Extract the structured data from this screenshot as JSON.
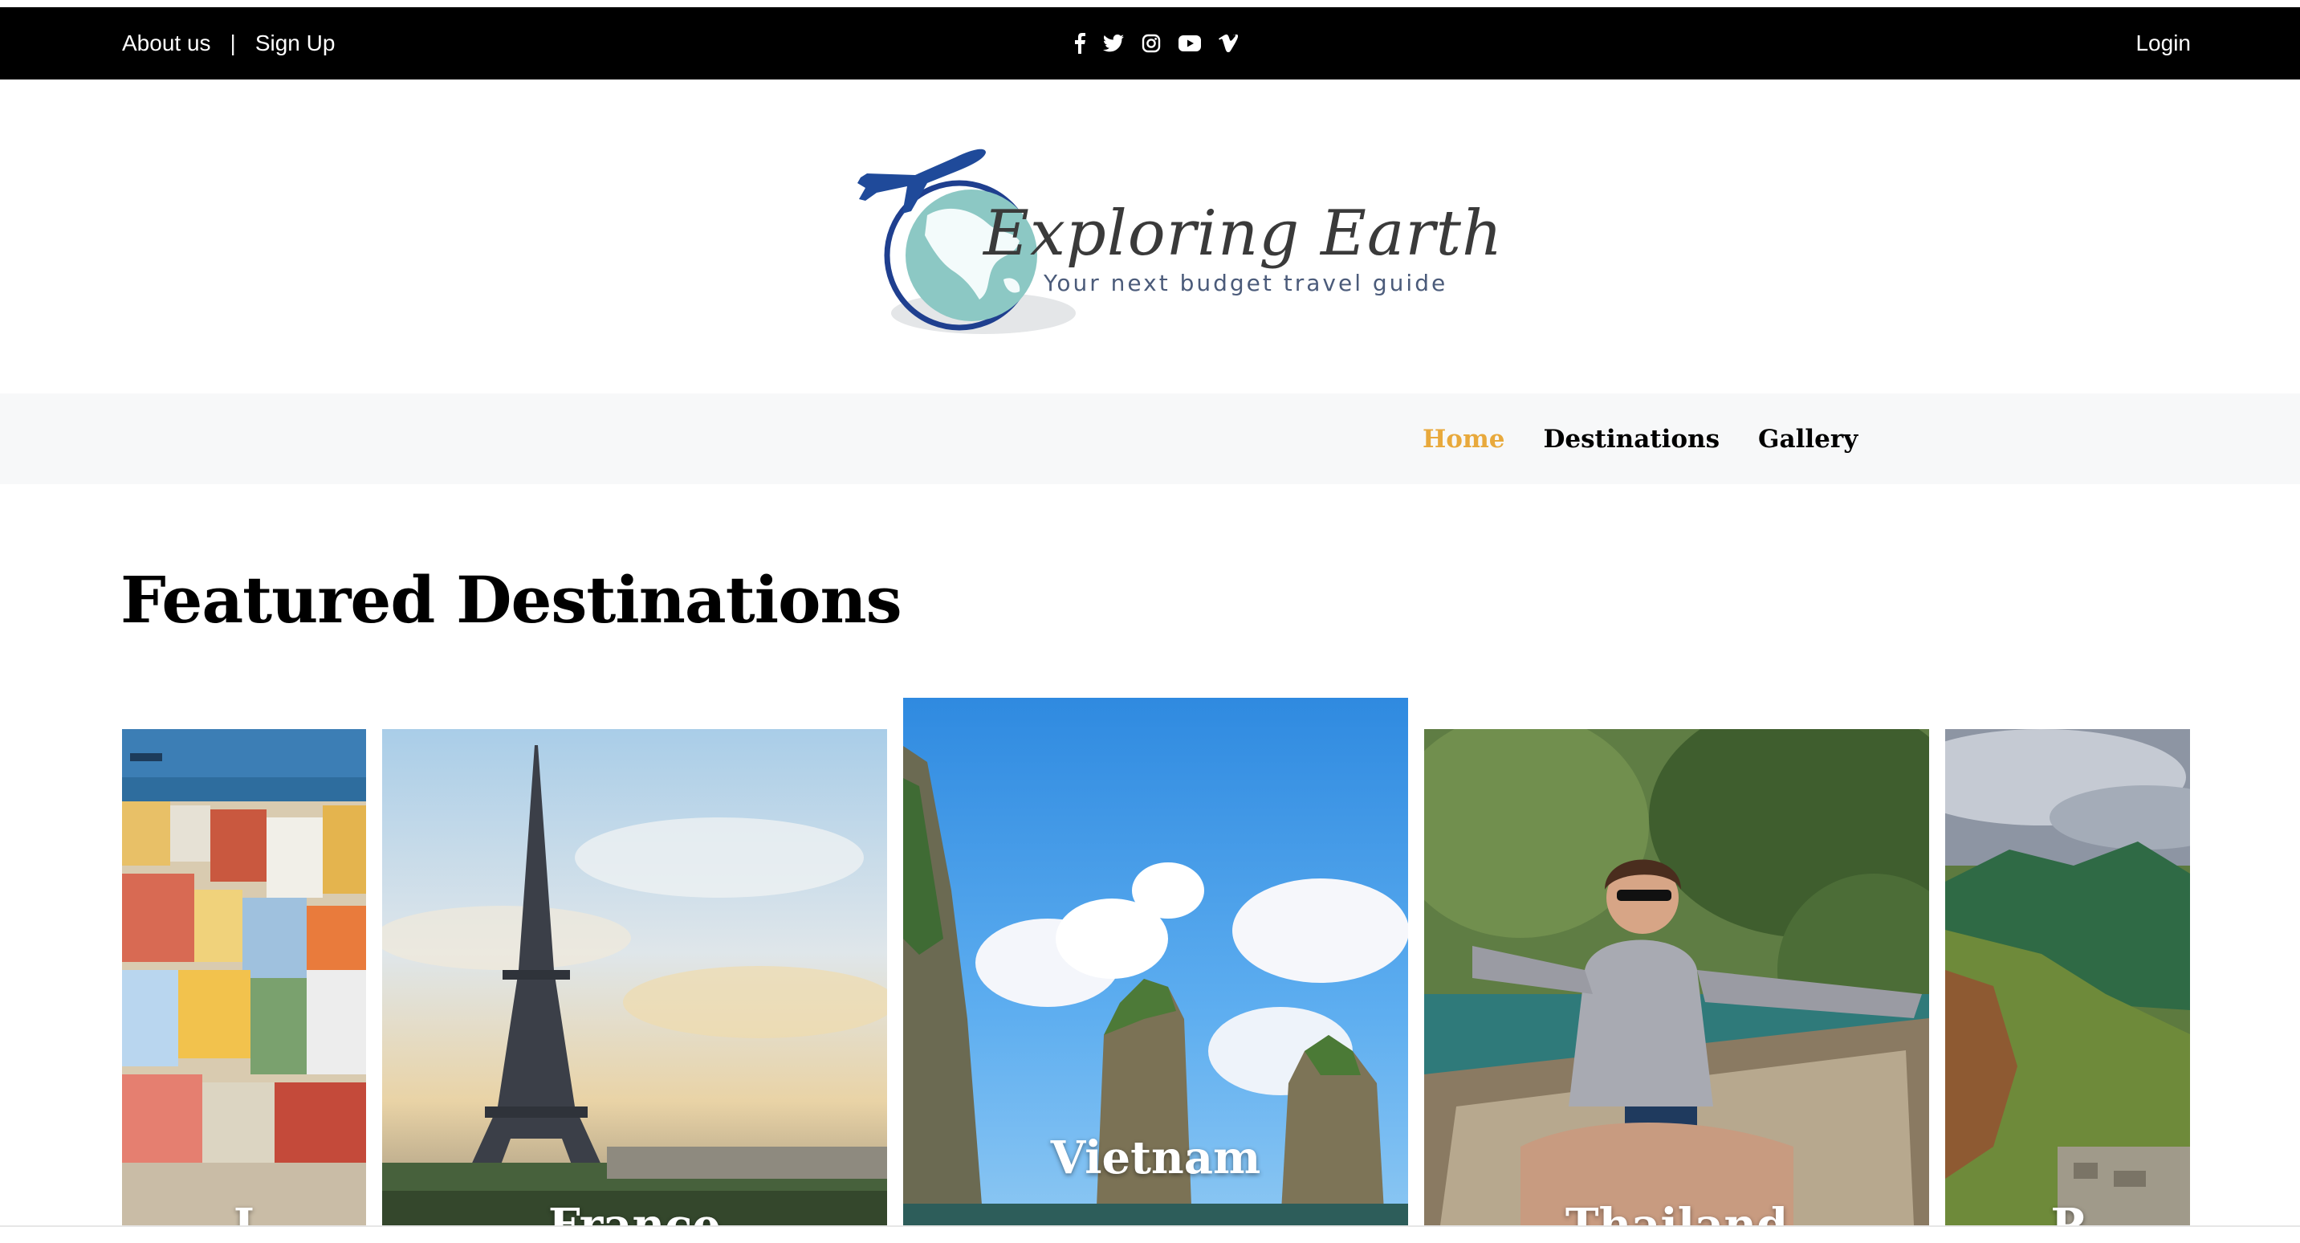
{
  "topbar": {
    "about_label": "About us",
    "separator": "|",
    "signup_label": "Sign Up",
    "login_label": "Login",
    "social_icons": [
      "facebook-icon",
      "twitter-icon",
      "instagram-icon",
      "youtube-icon",
      "vimeo-icon"
    ]
  },
  "brand": {
    "title": "Exploring Earth",
    "subtitle": "Your next budget travel guide"
  },
  "nav": {
    "items": [
      {
        "label": "Home",
        "active": true
      },
      {
        "label": "Destinations",
        "active": false
      },
      {
        "label": "Gallery",
        "active": false
      }
    ],
    "active_color": "#e8a93c"
  },
  "featured": {
    "title": "Featured Destinations",
    "cards": [
      {
        "label": "I"
      },
      {
        "label": "France"
      },
      {
        "label": "Vietnam"
      },
      {
        "label": "Thailand"
      },
      {
        "label": "P"
      }
    ]
  }
}
